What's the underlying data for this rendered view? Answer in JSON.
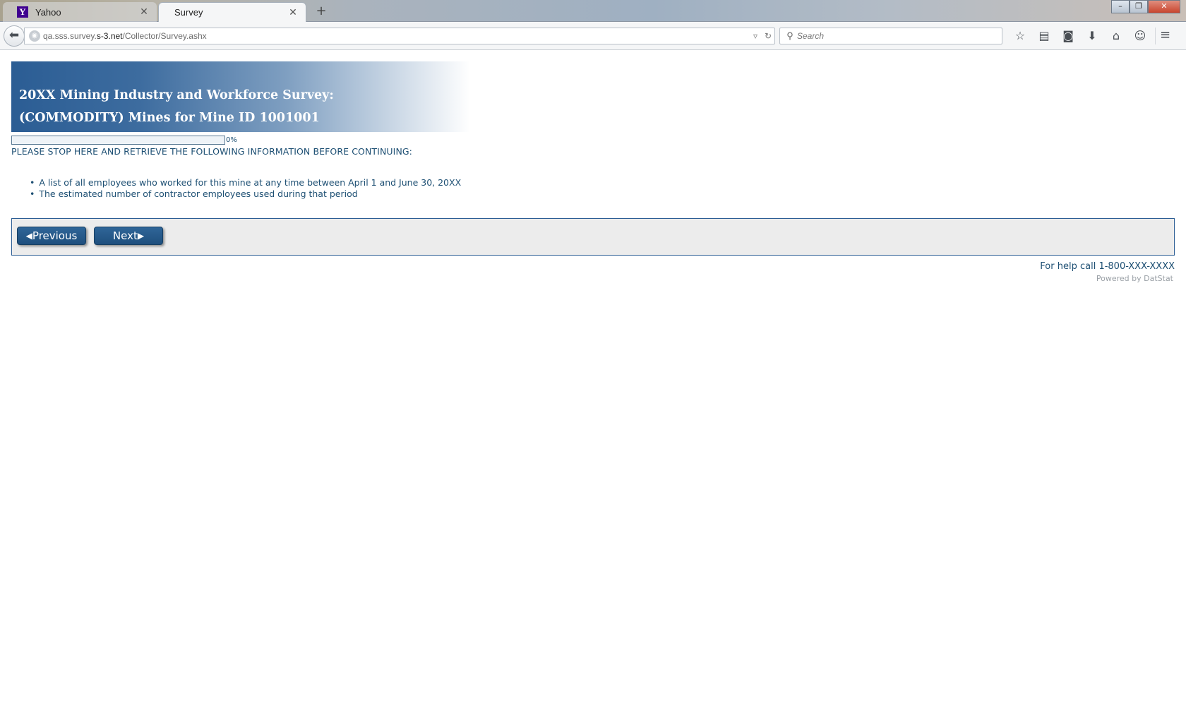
{
  "browser": {
    "tabs": [
      {
        "label": "Yahoo",
        "favicon": "Y",
        "active": false
      },
      {
        "label": "Survey",
        "active": true
      }
    ],
    "new_tab_glyph": "+",
    "url_prefix": "qa.sss.survey.",
    "url_domain": "s-3.net",
    "url_path": "/Collector/Survey.ashx",
    "search_placeholder": "Search",
    "window_controls": {
      "minimize": "–",
      "restore": "❐",
      "close": "✕"
    }
  },
  "survey": {
    "title_line1": "20XX Mining Industry and Workforce Survey:",
    "title_line2": "(COMMODITY) Mines for Mine ID 1001001",
    "progress_value": 0,
    "progress_text": "0%",
    "notice": "PLEASE STOP HERE AND RETRIEVE THE FOLLOWING INFORMATION BEFORE CONTINUING:",
    "requirements": [
      "A list of all employees who worked for this mine at any time between April 1 and June 30, 20XX",
      "The estimated number of contractor employees used during that period"
    ],
    "prev_label": "Previous",
    "next_label": "Next",
    "help_text": "For help call 1-800-XXX-XXXX",
    "powered_by": "Powered by DatStat"
  },
  "colors": {
    "accent": "#2b5d94",
    "text": "#1d4f73",
    "panel": "#ececec"
  }
}
